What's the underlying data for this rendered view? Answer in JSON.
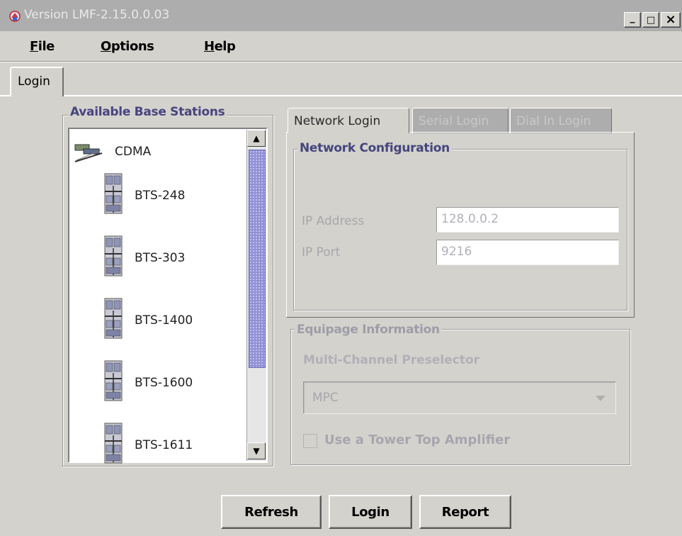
{
  "window": {
    "title": "Version LMF-2.15.0.0.03",
    "controls": [
      "_",
      "□",
      "×"
    ]
  },
  "menu": {
    "items": [
      {
        "label": "File",
        "mnemonic": "F",
        "rest": "ile"
      },
      {
        "label": "Options",
        "mnemonic": "O",
        "rest": "ptions"
      },
      {
        "label": "Help",
        "mnemonic": "H",
        "rest": "elp"
      }
    ]
  },
  "outer_tabs": [
    {
      "label": "Login",
      "active": true
    }
  ],
  "base_stations": {
    "title": "Available Base Stations",
    "root": {
      "label": "CDMA",
      "icon": "cdma-network-icon"
    },
    "items": [
      {
        "label": "BTS-248",
        "icon": "bts-cabinet-icon"
      },
      {
        "label": "BTS-303",
        "icon": "bts-cabinet-icon"
      },
      {
        "label": "BTS-1400",
        "icon": "bts-cabinet-icon"
      },
      {
        "label": "BTS-1600",
        "icon": "bts-cabinet-icon"
      },
      {
        "label": "BTS-1611",
        "icon": "bts-cabinet-icon"
      }
    ]
  },
  "login_tabs": [
    {
      "label": "Network Login",
      "active": true
    },
    {
      "label": "Serial Login",
      "active": false
    },
    {
      "label": "Dial In Login",
      "active": false
    }
  ],
  "network_config": {
    "title": "Network Configuration",
    "ip_address_label": "IP Address",
    "ip_address_value": "128.0.0.2",
    "ip_port_label": "IP Port",
    "ip_port_value": "9216"
  },
  "equipage": {
    "title": "Equipage Information",
    "mpc_label": "Multi-Channel Preselector",
    "mpc_selected": "MPC",
    "tower_top_label": "Use a Tower Top Amplifier",
    "tower_top_checked": false
  },
  "buttons": {
    "refresh": "Refresh",
    "login": "Login",
    "report": "Report"
  },
  "colors": {
    "background": "#d4d2cc",
    "titlebar": "#adadad",
    "group_title": "#45457e",
    "scroll_thumb": "#9090d4",
    "disabled_text": "#a6a6ae"
  }
}
